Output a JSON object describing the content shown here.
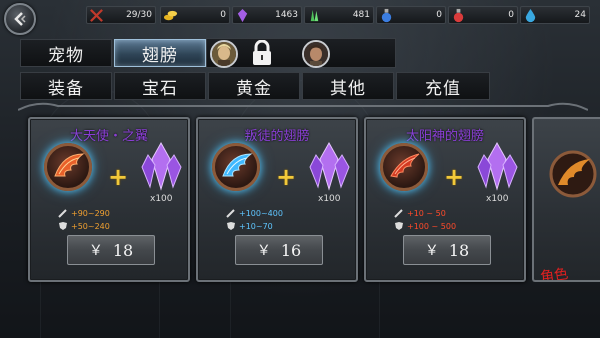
{
  "resources": [
    {
      "icon": "sword-crossed-icon",
      "value": "29/30",
      "color": "#c0392b"
    },
    {
      "icon": "gold-coins-icon",
      "value": "0",
      "color": "#e6b422"
    },
    {
      "icon": "purple-crystal-icon",
      "value": "1463",
      "color": "#a45ee5"
    },
    {
      "icon": "green-crystal-icon",
      "value": "481",
      "color": "#4fc35b"
    },
    {
      "icon": "blue-potion-icon",
      "value": "0",
      "color": "#3b7de0"
    },
    {
      "icon": "red-potion-icon",
      "value": "0",
      "color": "#d93b3b"
    },
    {
      "icon": "blue-drop-icon",
      "value": "24",
      "color": "#39a8e0"
    }
  ],
  "tabs_row1": [
    {
      "label": "宠物",
      "active": false
    },
    {
      "label": "翅膀",
      "active": true
    }
  ],
  "tabs_row2": [
    {
      "label": "装备"
    },
    {
      "label": "宝石"
    },
    {
      "label": "黄金"
    },
    {
      "label": "其他"
    },
    {
      "label": "充值"
    }
  ],
  "cards": [
    {
      "title": "大天使・之翼",
      "wing_color": "#e8602a",
      "quantity": "x100",
      "attack": "+90~290",
      "defense": "+50~240",
      "stat_color": "#f0a030",
      "currency": "￥",
      "price": "18"
    },
    {
      "title": "叛徒的翅膀",
      "wing_color": "#3fb8ff",
      "quantity": "x100",
      "attack": "+100~400",
      "defense": "+10~70",
      "stat_color": "#5fc6ff",
      "currency": "￥",
      "price": "16"
    },
    {
      "title": "太阳神的翅膀",
      "wing_color": "#d23a22",
      "quantity": "x100",
      "attack": "+10 ~ 50",
      "defense": "+100 ~ 500",
      "stat_color": "#ff4a2a",
      "currency": "￥",
      "price": "18"
    }
  ],
  "partial_card": {
    "text": "角色"
  },
  "colors": {
    "card_title": "#8b3fd6",
    "tab_active": "#3a5670",
    "plus": "#f2c93a"
  }
}
